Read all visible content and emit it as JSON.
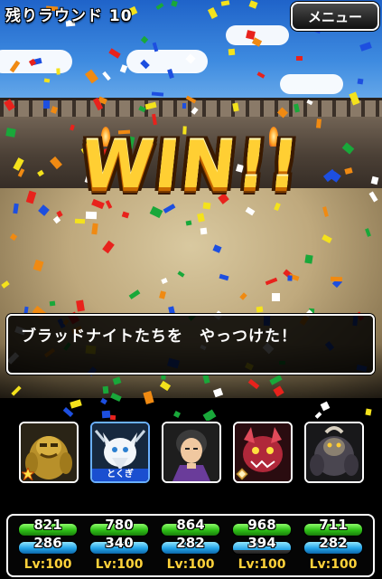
{
  "header": {
    "remaining_rounds": "残りラウンド 10",
    "menu_label": "メニュー"
  },
  "banner": {
    "text": "WIN!!"
  },
  "message": {
    "text": "ブラッドナイトたちを　やっつけた！"
  },
  "party": [
    {
      "name": "golden-monster",
      "tag": "",
      "badge": "burst-icon",
      "hp": "821",
      "mp": "286",
      "level": "Lv:100",
      "mp_fill": 1.0
    },
    {
      "name": "white-wolf-monster",
      "tag": "とくぎ",
      "badge": "",
      "hp": "780",
      "mp": "340",
      "level": "Lv:100",
      "mp_fill": 1.0
    },
    {
      "name": "hero-character",
      "tag": "",
      "badge": "",
      "hp": "864",
      "mp": "282",
      "level": "Lv:100",
      "mp_fill": 1.0
    },
    {
      "name": "red-demon-monster",
      "tag": "",
      "badge": "shield-icon",
      "hp": "968",
      "mp": "394",
      "level": "Lv:100",
      "mp_fill": 0.68
    },
    {
      "name": "gorilla-beast-monster",
      "tag": "",
      "badge": "",
      "hp": "711",
      "mp": "282",
      "level": "Lv:100",
      "mp_fill": 1.0
    }
  ],
  "colors": {
    "hp": "#2dbd16",
    "mp": "#22a3e8",
    "level": "#ffd23a",
    "active_border": "#6ab0ff"
  }
}
